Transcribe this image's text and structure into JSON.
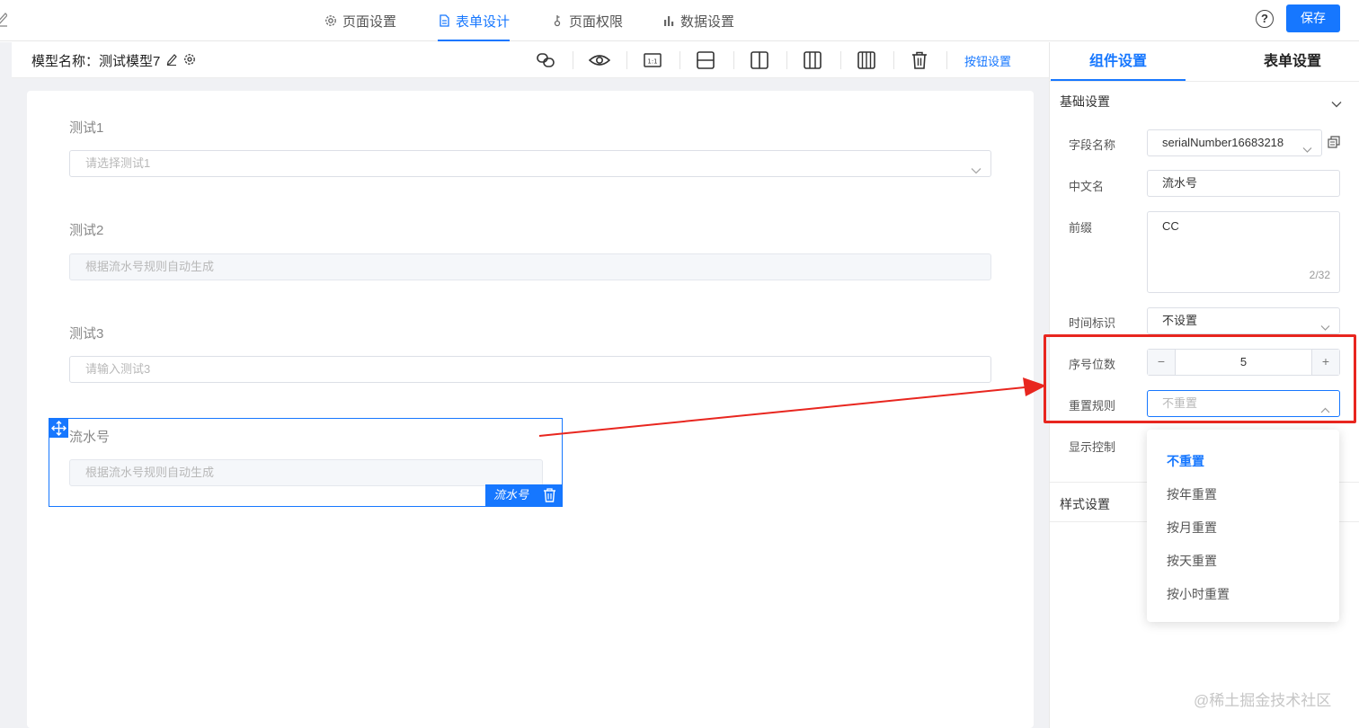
{
  "header": {
    "tabs": [
      {
        "label": "页面设置",
        "icon": "gear-icon"
      },
      {
        "label": "表单设计",
        "icon": "document-icon"
      },
      {
        "label": "页面权限",
        "icon": "key-icon"
      },
      {
        "label": "数据设置",
        "icon": "bar-chart-icon"
      }
    ],
    "active_tab": "表单设计",
    "help_label": "?",
    "save_label": "保存"
  },
  "toolbar": {
    "model_label": "模型名称：测试模型7",
    "button_settings_label": "按钮设置",
    "tools": [
      "link-icon",
      "eye-icon",
      "ratio-1-1-icon",
      "row-layout-icon",
      "two-column-icon",
      "three-column-icon",
      "four-column-icon",
      "trash-icon"
    ]
  },
  "form": {
    "fields": [
      {
        "label": "测试1",
        "placeholder": "请选择测试1",
        "kind": "select"
      },
      {
        "label": "测试2",
        "placeholder": "根据流水号规则自动生成",
        "kind": "disabled"
      },
      {
        "label": "测试3",
        "placeholder": "请输入测试3",
        "kind": "input"
      }
    ],
    "selected_field": {
      "label": "流水号",
      "placeholder": "根据流水号规则自动生成",
      "tag": "流水号"
    }
  },
  "panel": {
    "tabs": [
      "组件设置",
      "表单设置"
    ],
    "active_tab": "组件设置",
    "basic_section": "基础设置",
    "style_section": "样式设置",
    "rows": {
      "field_name": {
        "label": "字段名称",
        "value": "serialNumber16683218"
      },
      "chinese_name": {
        "label": "中文名",
        "value": "流水号"
      },
      "prefix": {
        "label": "前缀",
        "value": "CC",
        "counter": "2/32"
      },
      "time_mark": {
        "label": "时间标识",
        "value": "不设置"
      },
      "digits": {
        "label": "序号位数",
        "value": "5",
        "minus": "−",
        "plus": "+"
      },
      "reset_rule": {
        "label": "重置规则",
        "value": "不重置"
      },
      "display_control": {
        "label": "显示控制"
      }
    },
    "reset_options": [
      "不重置",
      "按年重置",
      "按月重置",
      "按天重置",
      "按小时重置"
    ],
    "selected_option": "不重置"
  },
  "colors": {
    "accent": "#1677ff",
    "annotation": "#e8261f"
  },
  "watermark": "@稀土掘金技术社区"
}
